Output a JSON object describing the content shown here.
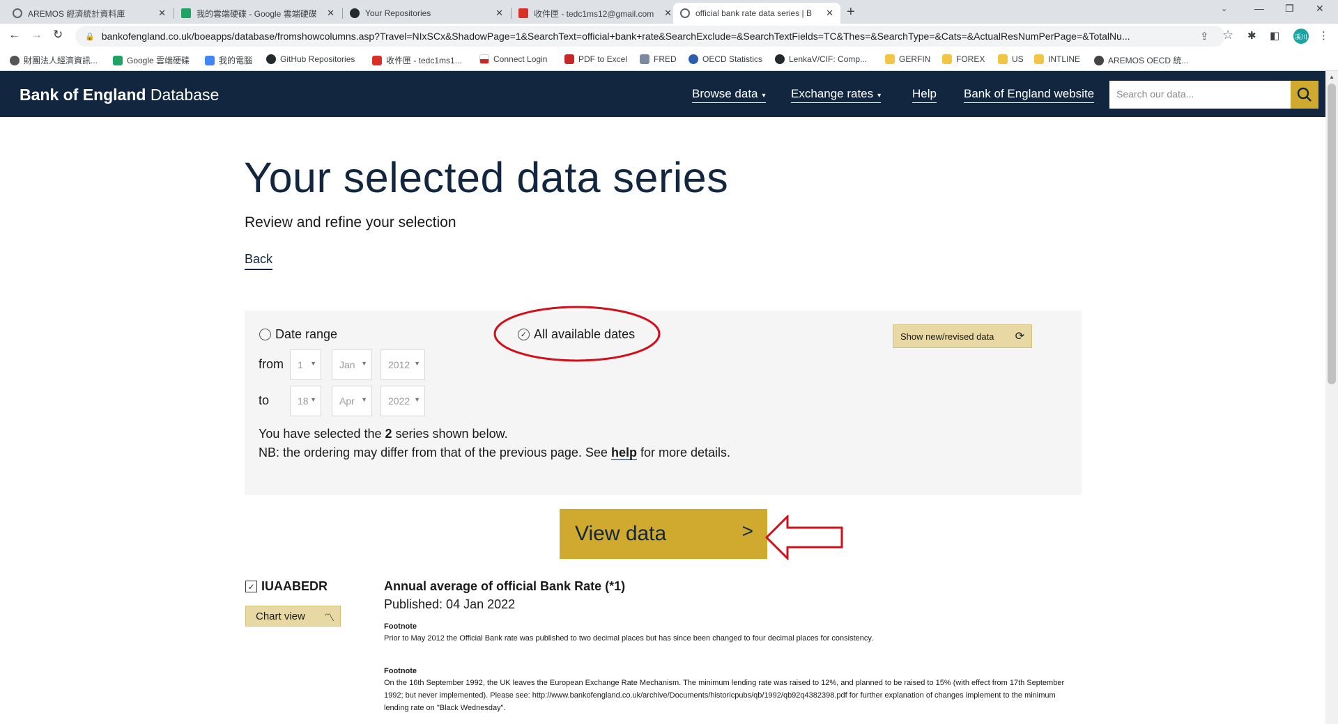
{
  "browser": {
    "tabs": [
      {
        "title": "AREMOS 經濟統計資料庫",
        "color": "#5f6368"
      },
      {
        "title": "我的雲端硬碟 - Google 雲端硬碟",
        "color": "#1fa463"
      },
      {
        "title": "Your Repositories",
        "color": "#24292e"
      },
      {
        "title": "收件匣 - tedc1ms12@gmail.com",
        "color": "#d93025"
      },
      {
        "title": "official bank rate data series | B",
        "color": "#5f6368"
      }
    ],
    "close_glyph": "✕",
    "new_tab_glyph": "+",
    "url": "bankofengland.co.uk/boeapps/database/fromshowcolumns.asp?Travel=NIxSCx&ShadowPage=1&SearchText=official+bank+rate&SearchExclude=&SearchTextFields=TC&Thes=&SearchType=&Cats=&ActualResNumPerPage=&TotalNu...",
    "profile_label": "溪川",
    "bookmarks": [
      {
        "label": "財團法人經濟資訊...",
        "color": "#555"
      },
      {
        "label": "Google 雲端硬碟",
        "color": "#1fa463"
      },
      {
        "label": "我的電腦",
        "color": "#4285f4"
      },
      {
        "label": "GitHub Repositories",
        "color": "#24292e"
      },
      {
        "label": "收件匣 - tedc1ms1...",
        "color": "#d93025"
      },
      {
        "label": "Connect Login",
        "color": "#c62828"
      },
      {
        "label": "PDF to Excel",
        "color": "#c62828"
      },
      {
        "label": "FRED",
        "color": "#7a8ba0"
      },
      {
        "label": "OECD Statistics",
        "color": "#2a5db0"
      },
      {
        "label": "LenkaV/CIF: Comp...",
        "color": "#24292e"
      },
      {
        "label": "GERFIN",
        "color": "#f4c542"
      },
      {
        "label": "FOREX",
        "color": "#f4c542"
      },
      {
        "label": "US",
        "color": "#f4c542"
      },
      {
        "label": "INTLINE",
        "color": "#f4c542"
      },
      {
        "label": "AREMOS OECD 統...",
        "color": "#444"
      }
    ]
  },
  "site": {
    "brand_bold": "Bank of England",
    "brand_rest": " Database",
    "nav": {
      "browse": "Browse data",
      "exchange": "Exchange rates",
      "help": "Help",
      "boe": "Bank of England website"
    },
    "search_placeholder": "Search our data..."
  },
  "page": {
    "title": "Your selected data series",
    "subtitle": "Review and refine your selection",
    "back": "Back"
  },
  "panel": {
    "date_range_label": "Date range",
    "all_dates_label": "All available dates",
    "show_new_label": "Show new/revised data",
    "from_label": "from",
    "to_label": "to",
    "from": {
      "day": "1",
      "month": "Jan",
      "year": "2012"
    },
    "to": {
      "day": "18",
      "month": "Apr",
      "year": "2022"
    },
    "selected_prefix": "You have selected the ",
    "selected_count": "2",
    "selected_suffix": " series shown below.",
    "nb_prefix": "NB: the ordering may differ from that of the previous page. See ",
    "nb_help": "help",
    "nb_suffix": " for more details."
  },
  "view_data": {
    "label": "View data",
    "chevron": ">"
  },
  "series": {
    "code": "IUAABEDR",
    "chart_view": "Chart view",
    "title": "Annual average of official Bank Rate (*1)",
    "published": "Published: 04 Jan 2022",
    "footnote_label": "Footnote",
    "footnote1": "Prior to May 2012 the Official Bank rate was published to two decimal places but has since been changed to four decimal places for consistency.",
    "footnote2": "On the 16th September 1992, the UK leaves the European Exchange Rate Mechanism. The minimum lending rate was raised to 12%, and planned to be raised to 15% (with effect from 17th September 1992; but never implemented). Please see: http://www.bankofengland.co.uk/archive/Documents/historicpubs/qb/1992/qb92q4382398.pdf for further explanation of changes implement to the minimum lending rate on \"Black Wednesday\"."
  },
  "colors": {
    "header_navy": "#12273f",
    "accent_gold": "#cfaa2f",
    "annotation_red": "#d0101a"
  }
}
